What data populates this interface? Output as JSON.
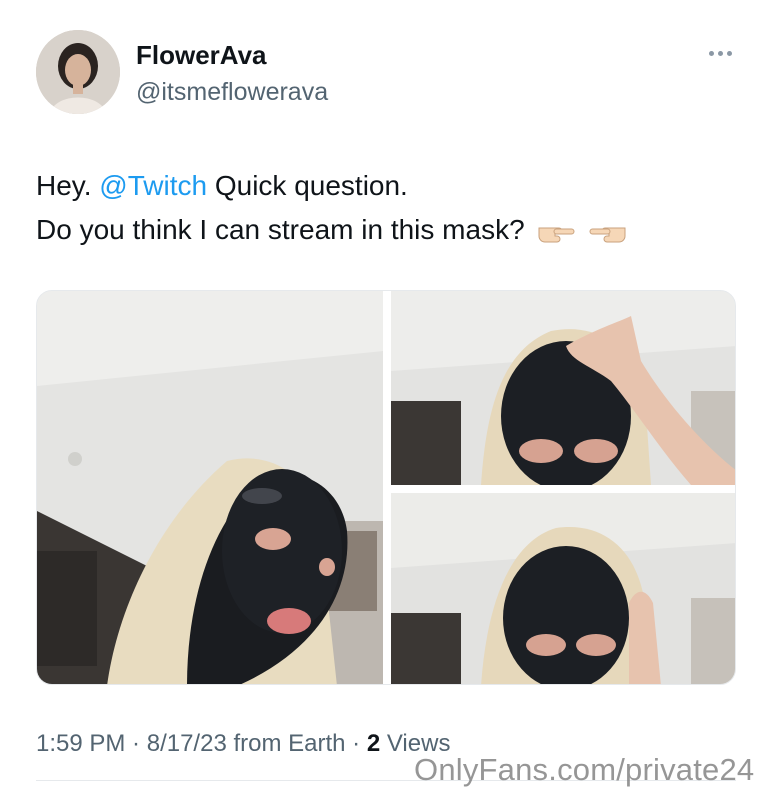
{
  "author": {
    "display_name": "FlowerAva",
    "handle": "@itsmeflowerava"
  },
  "tweet": {
    "line1_prefix": "Hey. ",
    "mention": "@Twitch",
    "line1_suffix": " Quick question.",
    "line2": "Do you think I can stream in this mask?",
    "emojis": [
      "backhand-index-pointing-right",
      "backhand-index-pointing-left"
    ]
  },
  "media": {
    "count": 3,
    "photos": [
      "photo-mask-selfie-wide",
      "photo-mask-selfie-hand-forehead",
      "photo-mask-selfie-hand-cheek"
    ]
  },
  "meta": {
    "time": "1:59 PM",
    "sep1": " · ",
    "date": "8/17/23",
    "source": " from Earth",
    "sep2": " · ",
    "views_count": "2",
    "views_label": " Views"
  },
  "watermark": "OnlyFans.com/private24",
  "colors": {
    "mention": "#1d9bf0",
    "secondary_text": "#536471",
    "primary_text": "#0f1419"
  }
}
